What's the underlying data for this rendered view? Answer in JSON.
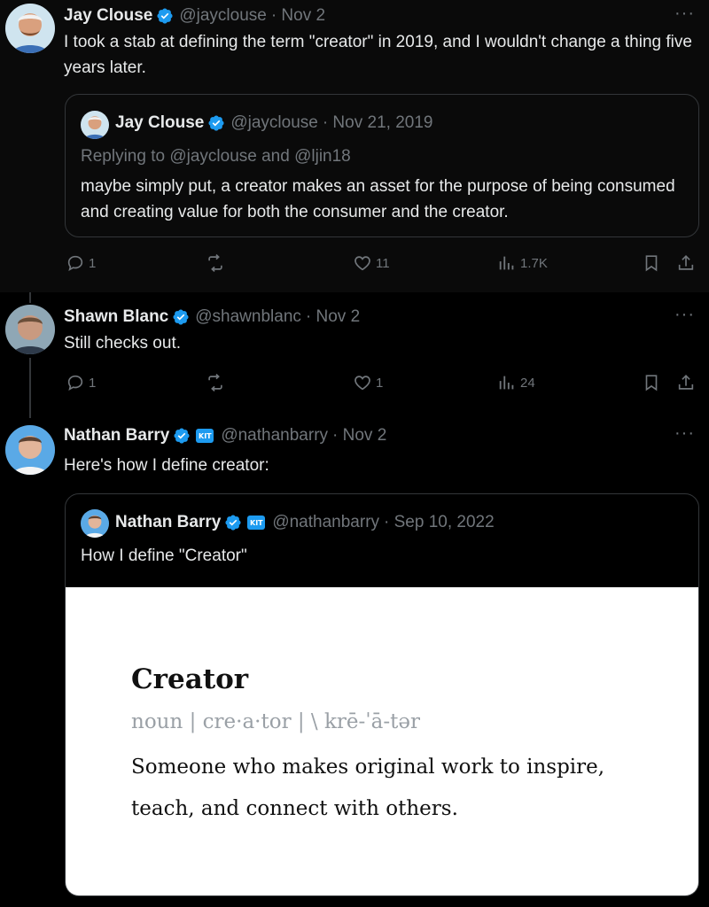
{
  "more_label": "···",
  "tweets": [
    {
      "name": "Jay Clouse",
      "handle": "@jayclouse",
      "date": "· Nov 2",
      "text": "I took a stab at defining the term \"creator\" in 2019, and I wouldn't change a thing five years later.",
      "quote": {
        "name": "Jay Clouse",
        "handle": "@jayclouse",
        "date": "· Nov 21, 2019",
        "replying": "Replying to @jayclouse and @ljin18",
        "text": "maybe simply put, a creator makes an asset for the purpose of being consumed and creating value for both the consumer and the creator."
      },
      "replies": "1",
      "retweets": "",
      "likes": "11",
      "views": "1.7K"
    },
    {
      "name": "Shawn Blanc",
      "handle": "@shawnblanc",
      "date": "· Nov 2",
      "text": "Still checks out.",
      "replies": "1",
      "retweets": "",
      "likes": "1",
      "views": "24"
    },
    {
      "name": "Nathan Barry",
      "handle": "@nathanbarry",
      "date": "· Nov 2",
      "badge": "KIT",
      "text": "Here's how I define creator:",
      "quote": {
        "name": "Nathan Barry",
        "handle": "@nathanbarry",
        "date": "· Sep 10, 2022",
        "badge": "KIT",
        "text": "How I define \"Creator\"",
        "card": {
          "word": "Creator",
          "pronunciation": "noun | cre·a·tor | \\ krē-ˈā-tər",
          "definition": "Someone who makes original work to inspire, teach, and connect with others."
        }
      }
    }
  ],
  "colors": {
    "verified": "#1d9bf0",
    "muted": "#71767b",
    "text": "#e7e9ea",
    "border": "#333639"
  }
}
